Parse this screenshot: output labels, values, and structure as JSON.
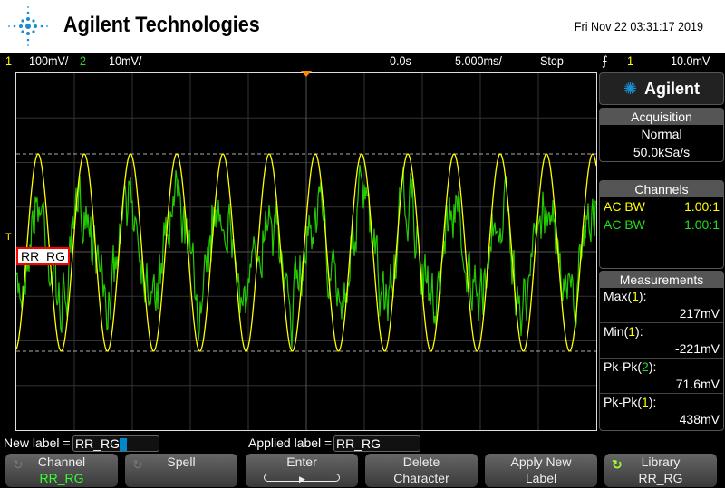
{
  "header": {
    "brand": "Agilent Technologies",
    "datetime": "Fri Nov 22 03:31:17 2019"
  },
  "status": {
    "ch1_num": "1",
    "ch1_scale": "100mV/",
    "ch2_num": "2",
    "ch2_scale": "10mV/",
    "delay": "0.0s",
    "timebase": "5.000ms/",
    "run_state": "Stop",
    "trigger_source": "1",
    "trigger_level": "10.0mV"
  },
  "colors": {
    "ch1": "#ffff00",
    "ch2": "#22cc00",
    "label_border": "#ff0000"
  },
  "plot": {
    "channel_label": "RR_RG",
    "trigger_marker": "T"
  },
  "side": {
    "brand": "Agilent",
    "acquisition": {
      "title": "Acquisition",
      "mode": "Normal",
      "rate": "50.0kSa/s"
    },
    "channels": {
      "title": "Channels",
      "rows": [
        {
          "name": "AC BW",
          "probe": "1.00:1"
        },
        {
          "name": "AC BW",
          "probe": "1.00:1"
        }
      ]
    },
    "measurements": {
      "title": "Measurements",
      "items": [
        {
          "label": "Max",
          "src": "1",
          "value": "217mV"
        },
        {
          "label": "Min",
          "src": "1",
          "value": "-221mV"
        },
        {
          "label": "Pk-Pk",
          "src": "2",
          "value": "71.6mV"
        },
        {
          "label": "Pk-Pk",
          "src": "1",
          "value": "438mV"
        }
      ]
    }
  },
  "label_bar": {
    "new_label_prefix": "New label = ",
    "new_label_value": "RR_RG",
    "applied_prefix": "Applied label = ",
    "applied_value": "RR_RG"
  },
  "softkeys": [
    {
      "line1": "Channel",
      "line2": "RR_RG"
    },
    {
      "line1": "Spell",
      "line2": ""
    },
    {
      "line1": "Enter",
      "line2": ""
    },
    {
      "line1": "Delete",
      "line2": "Character"
    },
    {
      "line1": "Apply New",
      "line2": "Label"
    },
    {
      "line1": "Library",
      "line2": "RR_RG"
    }
  ]
}
